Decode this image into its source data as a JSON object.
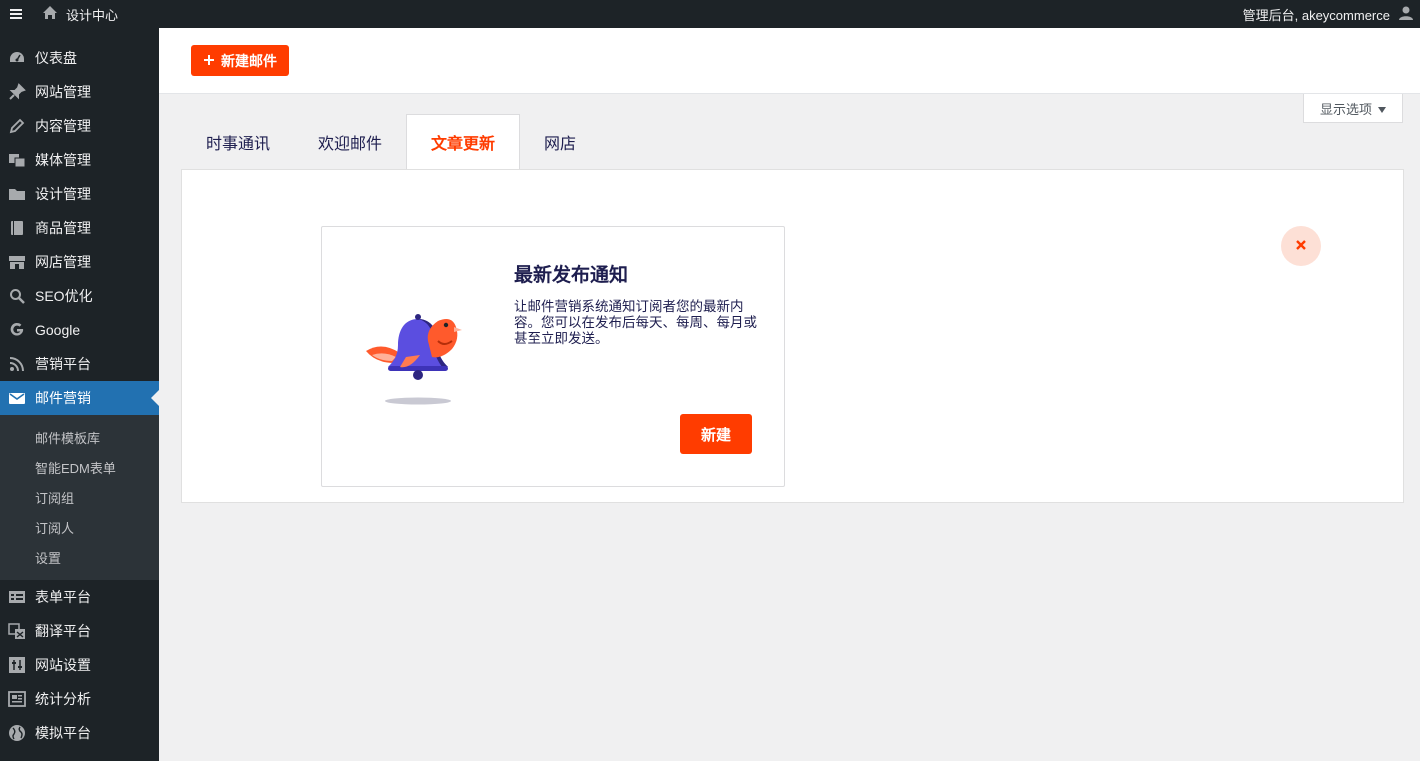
{
  "topbar": {
    "site_name": "设计中心",
    "user_greeting": "管理后台, akeycommerce",
    "menu_icon": "hamburger-icon",
    "home_icon": "home-icon",
    "user_icon": "user-icon"
  },
  "sidebar": {
    "items": [
      {
        "label": "仪表盘",
        "icon": "dashboard-icon"
      },
      {
        "label": "网站管理",
        "icon": "pin-icon"
      },
      {
        "label": "内容管理",
        "icon": "edit-icon"
      },
      {
        "label": "媒体管理",
        "icon": "media-icon"
      },
      {
        "label": "设计管理",
        "icon": "folder-icon"
      },
      {
        "label": "商品管理",
        "icon": "book-icon"
      },
      {
        "label": "网店管理",
        "icon": "store-icon"
      },
      {
        "label": "SEO优化",
        "icon": "search-icon"
      },
      {
        "label": "Google",
        "icon": "google-icon"
      },
      {
        "label": "营销平台",
        "icon": "rss-icon"
      },
      {
        "label": "邮件营销",
        "icon": "mail-icon",
        "active": true
      }
    ],
    "submenu": [
      "邮件模板库",
      "智能EDM表单",
      "订阅组",
      "订阅人",
      "设置"
    ],
    "items_after": [
      {
        "label": "表单平台",
        "icon": "form-icon"
      },
      {
        "label": "翻译平台",
        "icon": "translate-icon"
      },
      {
        "label": "网站设置",
        "icon": "settings-icon"
      },
      {
        "label": "统计分析",
        "icon": "analytics-icon"
      },
      {
        "label": "模拟平台",
        "icon": "globe-icon"
      }
    ]
  },
  "header": {
    "new_mail_button": "新建邮件",
    "screen_options": "显示选项"
  },
  "tabs": [
    {
      "label": "时事通讯"
    },
    {
      "label": "欢迎邮件"
    },
    {
      "label": "文章更新",
      "active": true
    },
    {
      "label": "网店"
    }
  ],
  "card": {
    "title": "最新发布通知",
    "description": "让邮件营销系统通知订阅者您的最新内容。您可以在发布后每天、每周、每月或甚至立即发送。",
    "button": "新建"
  },
  "colors": {
    "accent": "#ff3c00",
    "sidebar_bg": "#1d2327",
    "active_menu": "#2271b1",
    "text_dark": "#1e1e4f"
  }
}
